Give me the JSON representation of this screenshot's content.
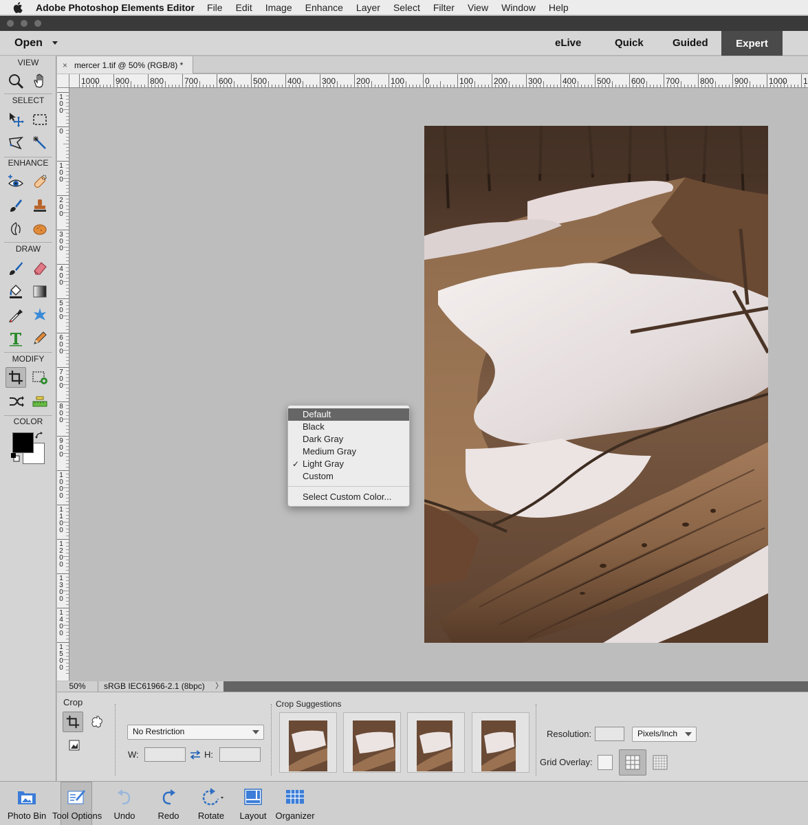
{
  "menubar": {
    "app_name": "Adobe Photoshop Elements Editor",
    "items": [
      "File",
      "Edit",
      "Image",
      "Enhance",
      "Layer",
      "Select",
      "Filter",
      "View",
      "Window",
      "Help"
    ]
  },
  "modebar": {
    "open_label": "Open",
    "modes": [
      "eLive",
      "Quick",
      "Guided",
      "Expert"
    ],
    "active_mode": "Expert"
  },
  "toolbox": {
    "sections": [
      "VIEW",
      "SELECT",
      "ENHANCE",
      "DRAW",
      "MODIFY",
      "COLOR"
    ],
    "foreground_color": "#000000",
    "background_color": "#ffffff"
  },
  "document": {
    "tab_title": "mercer 1.tif @ 50% (RGB/8) *",
    "close_glyph": "×"
  },
  "rulers": {
    "top_labels": [
      "1000",
      "900",
      "800",
      "700",
      "600",
      "500",
      "400",
      "300",
      "200",
      "100",
      "0",
      "100",
      "200",
      "300",
      "400",
      "500",
      "600",
      "700",
      "800",
      "900",
      "1000",
      "1"
    ],
    "left_labels": [
      "1\n0\n0",
      "0",
      "1\n0\n0",
      "2\n0\n0",
      "3\n0\n0",
      "4\n0\n0",
      "5\n0\n0",
      "6\n0\n0",
      "7\n0\n0",
      "8\n0\n0",
      "9\n0\n0",
      "1\n0\n0\n0",
      "1\n1\n0\n0",
      "1\n2\n0\n0",
      "1\n3\n0\n0",
      "1\n4\n0\n0",
      "1\n5\n0\n0"
    ]
  },
  "context_menu": {
    "items": [
      "Default",
      "Black",
      "Dark Gray",
      "Medium Gray",
      "Light Gray",
      "Custom"
    ],
    "highlighted": "Default",
    "checked": "Light Gray",
    "check_glyph": "✓",
    "extra": "Select Custom Color..."
  },
  "status": {
    "zoom": "50%",
    "profile": "sRGB IEC61966-2.1 (8bpc)",
    "arrow": "〉"
  },
  "options": {
    "tool_name": "Crop",
    "restriction": "No Restriction",
    "w_label": "W:",
    "h_label": "H:",
    "suggestions_title": "Crop Suggestions",
    "resolution_label": "Resolution:",
    "resolution_unit": "Pixels/Inch",
    "grid_overlay_label": "Grid Overlay:"
  },
  "taskbar": {
    "items": [
      "Photo Bin",
      "Tool Options",
      "Undo",
      "Redo",
      "Rotate",
      "Layout",
      "Organizer"
    ]
  },
  "colors": {
    "canvas_bg": "#bdbdbd",
    "menu_highlight": "#666666",
    "expert_tab": "#4a4a4a"
  }
}
